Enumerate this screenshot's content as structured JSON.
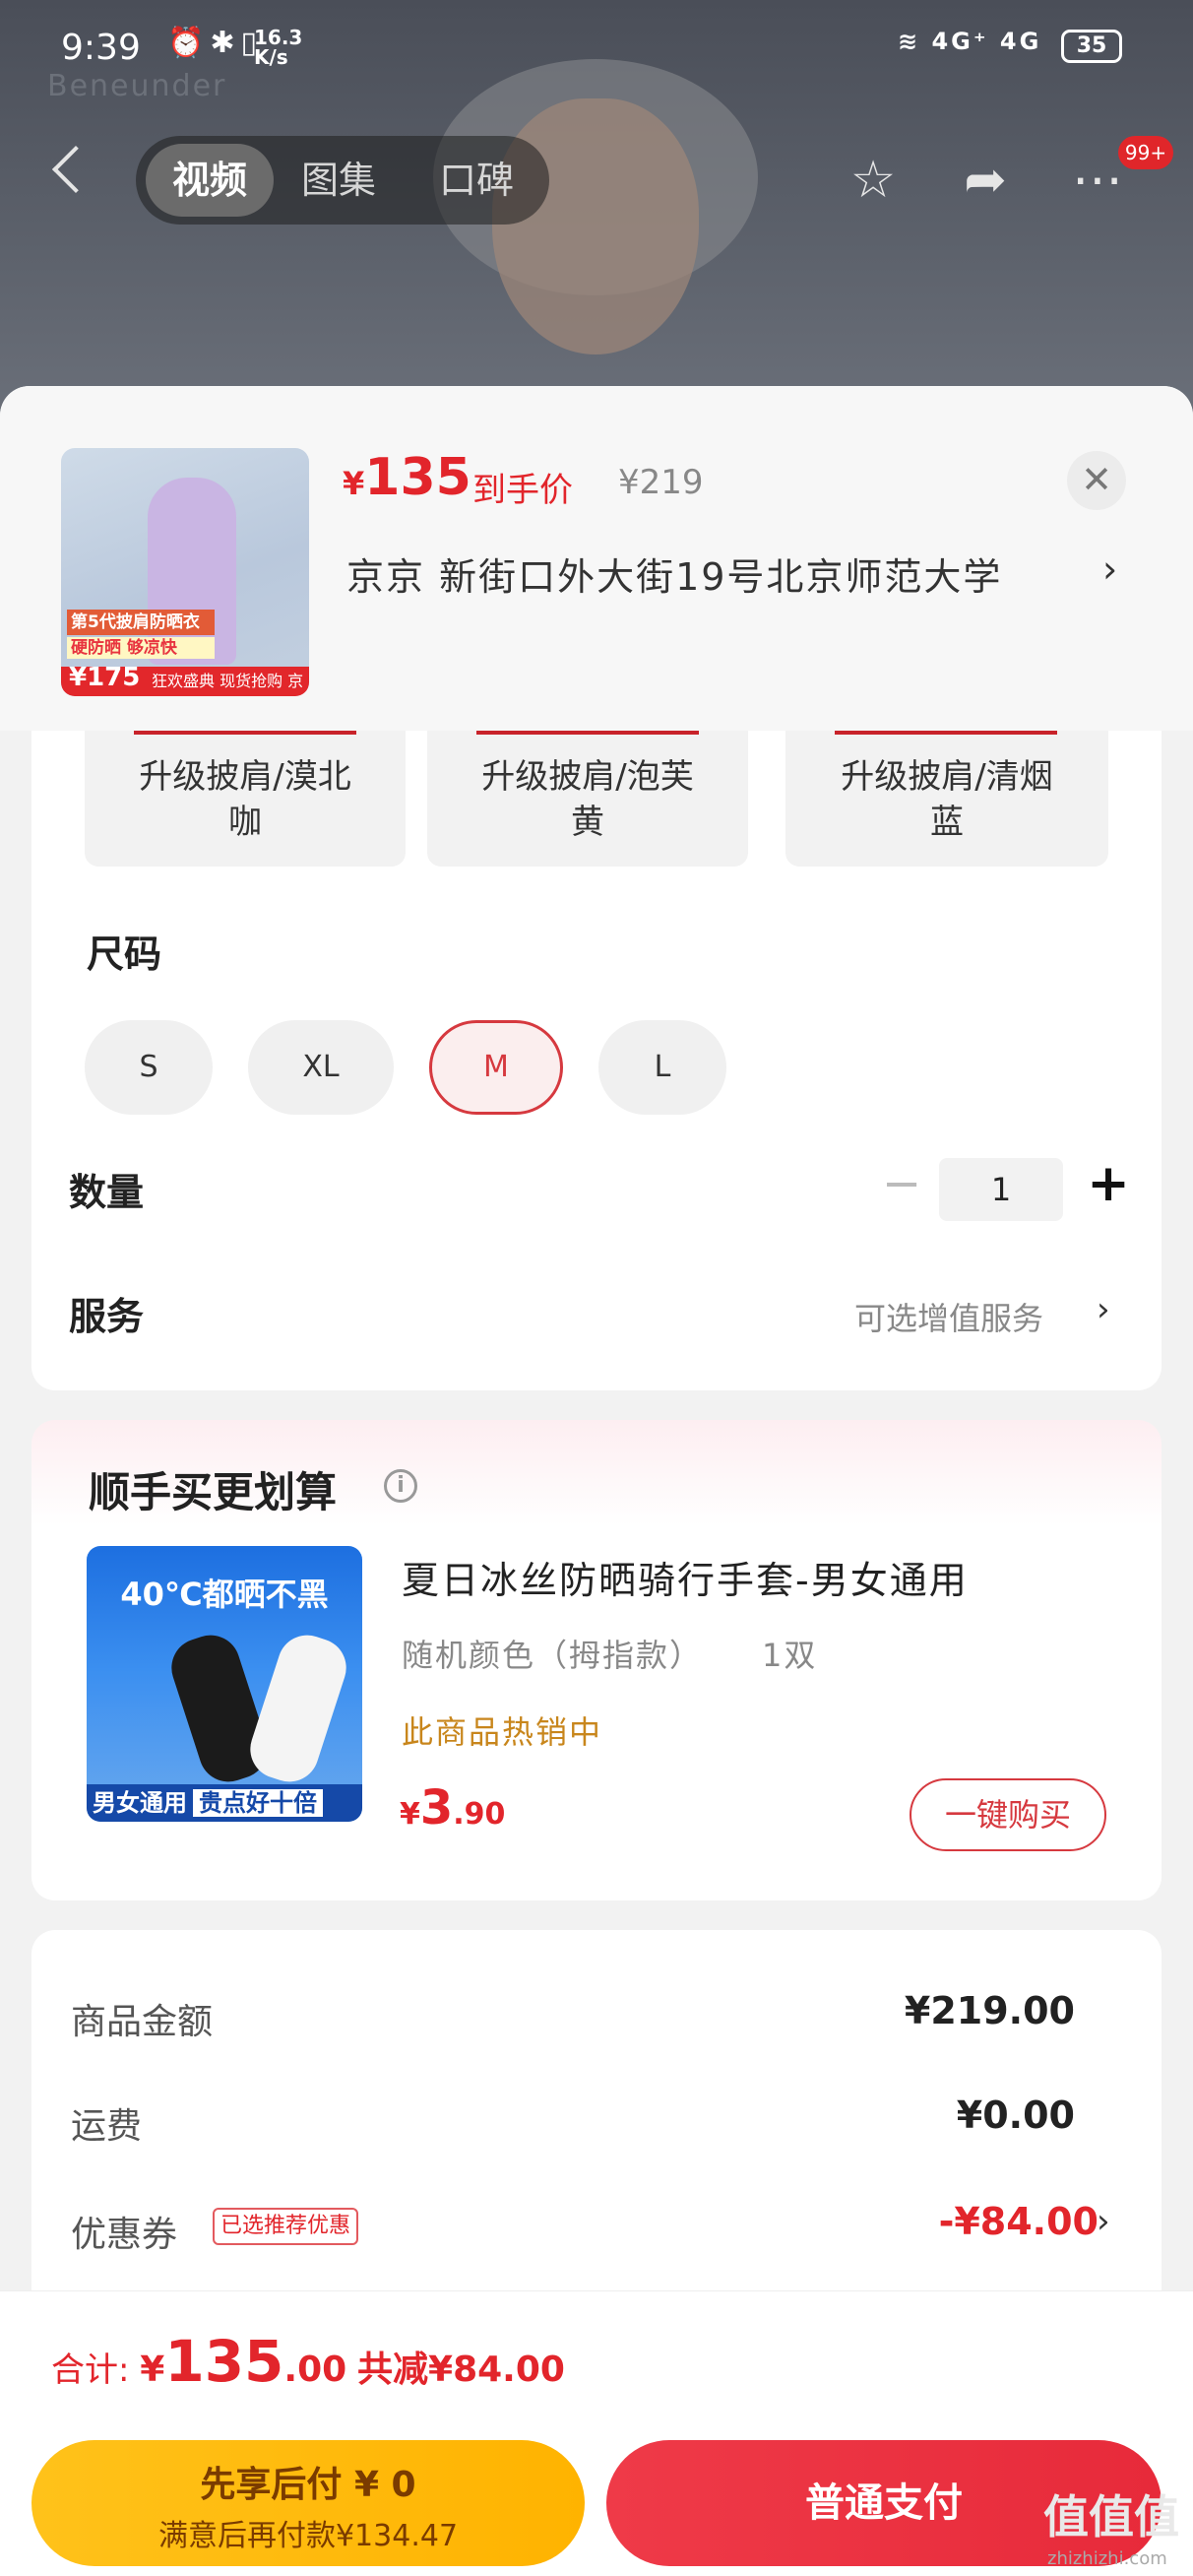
{
  "status_bar": {
    "time": "9:39",
    "net_speed_value": "16.3",
    "net_speed_unit": "K/s",
    "signal_labels": "4G⁺ 4G",
    "battery": "35"
  },
  "background": {
    "brand_text": "Beneunder"
  },
  "nav": {
    "tabs": [
      "视频",
      "图集",
      "口碑"
    ],
    "active_tab": "视频",
    "badge": "99+"
  },
  "product": {
    "price_symbol": "¥",
    "price": "135",
    "price_label": "到手价",
    "original_price": "¥219",
    "address": "京京   新街口外大街19号北京师范大学",
    "thumb_line1": "第5代披肩防晒衣",
    "thumb_line2": "硬防晒 够凉快",
    "thumb_price": "¥175",
    "thumb_banner": "狂欢盛典 现货抢购 京东"
  },
  "specs": {
    "colors": [
      "升级披肩/漠北\n咖",
      "升级披肩/泡芙\n黄",
      "升级披肩/清烟\n蓝"
    ],
    "size_title": "尺码",
    "sizes": [
      "S",
      "XL",
      "M",
      "L"
    ],
    "selected_size": "M",
    "quantity_label": "数量",
    "quantity": "1",
    "service_label": "服务",
    "service_value": "可选增值服务"
  },
  "addon": {
    "title": "顺手买更划算",
    "image_headline": "40℃都晒不黑",
    "image_footer": "男女通用",
    "image_footer_tag": "贵点好十倍",
    "name": "夏日冰丝防晒骑行手套-男女通用",
    "spec": "随机颜色（拇指款）",
    "count": "1双",
    "hot": "此商品热销中",
    "price_symbol": "¥",
    "price_int": "3",
    "price_dec": ".90",
    "buy_label": "一键购买"
  },
  "summary": {
    "goods_label": "商品金额",
    "goods_value": "¥219.00",
    "shipping_label": "运费",
    "shipping_value": "¥0.00",
    "coupon_label": "优惠券",
    "coupon_tag": "已选推荐优惠",
    "coupon_value": "-¥84.00"
  },
  "bottom": {
    "total_label": "合计:",
    "total_symbol": "¥",
    "total_int": "135",
    "total_dec": ".00",
    "discount_label": "共减",
    "discount_value": "¥84.00",
    "pay_later_title": "先享后付 ¥ 0",
    "pay_later_sub": "满意后再付款¥134.47",
    "pay_normal": "普通支付"
  },
  "watermark": {
    "text": "值值值",
    "domain": "zhizhizhi.com"
  },
  "colors": {
    "accent_red": "#e2252b",
    "pay_later_yellow": "#ffb300",
    "hot_text": "#c8861c"
  }
}
